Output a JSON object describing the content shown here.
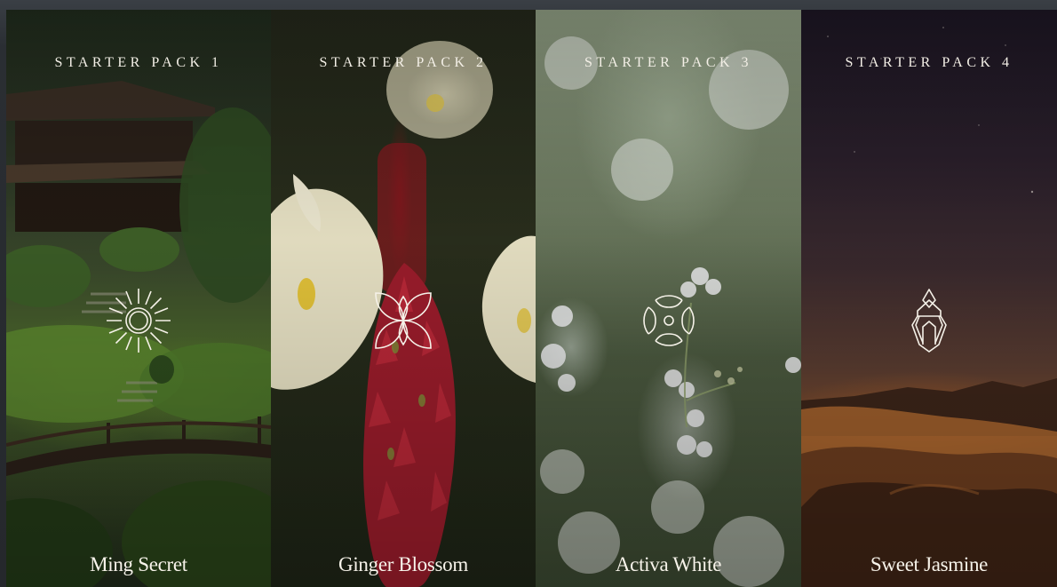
{
  "cards": [
    {
      "pack_label": "STARTER PACK 1",
      "name": "Ming Secret",
      "icon": "sun-icon"
    },
    {
      "pack_label": "STARTER PACK 2",
      "name": "Ginger Blossom",
      "icon": "petals-icon"
    },
    {
      "pack_label": "STARTER PACK 3",
      "name": "Activa White",
      "icon": "flower-ring-icon"
    },
    {
      "pack_label": "STARTER PACK 4",
      "name": "Sweet Jasmine",
      "icon": "temple-icon"
    }
  ],
  "colors": {
    "text": "#f3efe6",
    "icon_stroke": "#f5f1e8",
    "page_background": "#2a2d31"
  }
}
